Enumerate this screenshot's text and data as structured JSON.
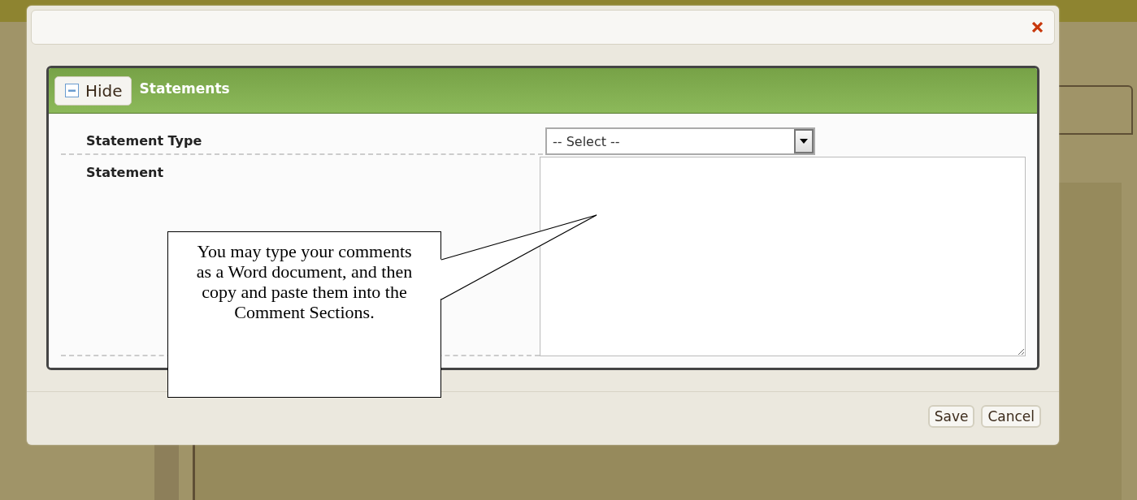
{
  "panel": {
    "toggle_label": "Hide",
    "title": "Statements",
    "expanded": true
  },
  "fields": [
    {
      "kind": "select",
      "label": "Statement Type",
      "value": "-- Select --"
    },
    {
      "kind": "textarea",
      "label": "Statement"
    }
  ],
  "callout": {
    "text": "You may type your comments as a Word document, and then copy and paste them into the Comment Sections."
  },
  "buttons": [
    "Save",
    "Cancel"
  ]
}
